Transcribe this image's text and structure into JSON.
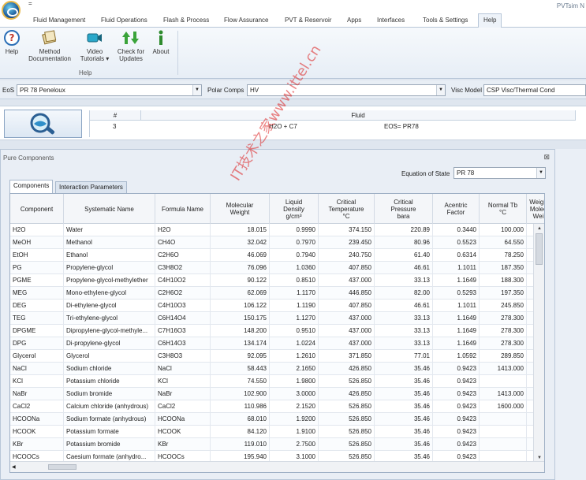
{
  "app": {
    "title": "PVTsim N",
    "qat_glyph": "="
  },
  "tabs": [
    {
      "label": "Fluid Management"
    },
    {
      "label": "Fluid Operations"
    },
    {
      "label": "Flash & Process"
    },
    {
      "label": "Flow Assurance"
    },
    {
      "label": "PVT & Reservoir"
    },
    {
      "label": "Apps"
    },
    {
      "label": "Interfaces"
    },
    {
      "label": "Tools & Settings"
    },
    {
      "label": "Help"
    }
  ],
  "ribbon": {
    "help": "Help",
    "method_doc_1": "Method",
    "method_doc_2": "Documentation",
    "video_1": "Video",
    "video_2": "Tutorials ▾",
    "updates_1": "Check for",
    "updates_2": "Updates",
    "about": "About",
    "group_label": "Help"
  },
  "eos_bar": {
    "eos_label": "EoS",
    "eos_value": "PR 78 Peneloux",
    "polar_label": "Polar Comps",
    "polar_value": "HV",
    "visc_label": "Visc Model",
    "visc_value": "CSP Visc/Thermal Cond"
  },
  "fluid_strip": {
    "col_num": "#",
    "col_fluid": "Fluid",
    "num": "3",
    "fluid": "H2O + C7",
    "eos": "EOS= PR78"
  },
  "panel": {
    "title": "Pure Components",
    "close": "⊠",
    "eos_label": "Equation of State",
    "eos_value": "PR 78",
    "tab_components": "Components",
    "tab_interaction": "Interaction Parameters"
  },
  "columns": [
    "Component",
    "Systematic Name",
    "Formula Name",
    "Molecular\nWeight",
    "Liquid\nDensity\ng/cm³",
    "Critical\nTemperature\n°C",
    "Critical\nPressure\nbara",
    "Acentric\nFactor",
    "Normal Tb\n°C",
    "Weigh\nMolec\nWei"
  ],
  "rows": [
    [
      "H2O",
      "Water",
      "H2O",
      "18.015",
      "0.9990",
      "374.150",
      "220.89",
      "0.3440",
      "100.000"
    ],
    [
      "MeOH",
      "Methanol",
      "CH4O",
      "32.042",
      "0.7970",
      "239.450",
      "80.96",
      "0.5523",
      "64.550"
    ],
    [
      "EtOH",
      "Ethanol",
      "C2H6O",
      "46.069",
      "0.7940",
      "240.750",
      "61.40",
      "0.6314",
      "78.250"
    ],
    [
      "PG",
      "Propylene-glycol",
      "C3H8O2",
      "76.096",
      "1.0360",
      "407.850",
      "46.61",
      "1.1011",
      "187.350"
    ],
    [
      "PGME",
      "Propylene-glycol-methylether",
      "C4H10O2",
      "90.122",
      "0.8510",
      "437.000",
      "33.13",
      "1.1649",
      "188.300"
    ],
    [
      "MEG",
      "Mono-ethylene-glycol",
      "C2H6O2",
      "62.069",
      "1.1170",
      "446.850",
      "82.00",
      "0.5293",
      "197.350"
    ],
    [
      "DEG",
      "Di-ethylene-glycol",
      "C4H10O3",
      "106.122",
      "1.1190",
      "407.850",
      "46.61",
      "1.1011",
      "245.850"
    ],
    [
      "TEG",
      "Tri-ethylene-glycol",
      "C6H14O4",
      "150.175",
      "1.1270",
      "437.000",
      "33.13",
      "1.1649",
      "278.300"
    ],
    [
      "DPGME",
      "Dipropylene-glycol-methyle...",
      "C7H16O3",
      "148.200",
      "0.9510",
      "437.000",
      "33.13",
      "1.1649",
      "278.300"
    ],
    [
      "DPG",
      "Di-propylene-glycol",
      "C6H14O3",
      "134.174",
      "1.0224",
      "437.000",
      "33.13",
      "1.1649",
      "278.300"
    ],
    [
      "Glycerol",
      "Glycerol",
      "C3H8O3",
      "92.095",
      "1.2610",
      "371.850",
      "77.01",
      "1.0592",
      "289.850"
    ],
    [
      "NaCl",
      "Sodium chloride",
      "NaCl",
      "58.443",
      "2.1650",
      "426.850",
      "35.46",
      "0.9423",
      "1413.000"
    ],
    [
      "KCl",
      "Potassium chloride",
      "KCl",
      "74.550",
      "1.9800",
      "526.850",
      "35.46",
      "0.9423",
      ""
    ],
    [
      "NaBr",
      "Sodium bromide",
      "NaBr",
      "102.900",
      "3.0000",
      "426.850",
      "35.46",
      "0.9423",
      "1413.000"
    ],
    [
      "CaCl2",
      "Calcium chloride (anhydrous)",
      "CaCl2",
      "110.986",
      "2.1520",
      "526.850",
      "35.46",
      "0.9423",
      "1600.000"
    ],
    [
      "HCOONa",
      "Sodium formate (anhydrous)",
      "HCOONa",
      "68.010",
      "1.9200",
      "526.850",
      "35.46",
      "0.9423",
      ""
    ],
    [
      "HCOOK",
      "Potassium formate",
      "HCOOK",
      "84.120",
      "1.9100",
      "526.850",
      "35.46",
      "0.9423",
      ""
    ],
    [
      "KBr",
      "Potassium bromide",
      "KBr",
      "119.010",
      "2.7500",
      "526.850",
      "35.46",
      "0.9423",
      ""
    ],
    [
      "HCOOCs",
      "Caesium formate (anhydro...",
      "HCOOCs",
      "195.940",
      "3.1000",
      "526.850",
      "35.46",
      "0.9423",
      ""
    ]
  ],
  "watermark": "IT技术之家www.ittel.cn"
}
